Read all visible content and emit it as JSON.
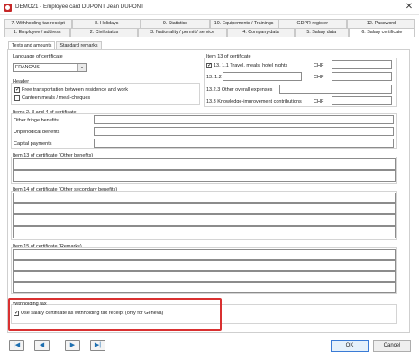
{
  "window": {
    "title": "DEMO21 - Employee card DUPONT  Jean DUPONT",
    "close_glyph": "✕"
  },
  "tabs_row1": [
    {
      "label": "7. Withholding tax receipt"
    },
    {
      "label": "8. Holidays"
    },
    {
      "label": "9. Statistics"
    },
    {
      "label": "10. Equipements / Trainings"
    },
    {
      "label": "GDPR register"
    },
    {
      "label": "12. Password"
    }
  ],
  "tabs_row2": [
    {
      "label": "1. Employee / address"
    },
    {
      "label": "2. Civil status"
    },
    {
      "label": "3. Nationality / permit / service"
    },
    {
      "label": "4. Company data"
    },
    {
      "label": "5. Salary data"
    },
    {
      "label": "6. Salary certificate"
    }
  ],
  "subtabs": [
    {
      "label": "Texts and amounts"
    },
    {
      "label": "Standard remarks"
    }
  ],
  "language": {
    "label": "Language of certificate",
    "value": "FRANCAIS"
  },
  "header": {
    "label": "Header",
    "free_transport": {
      "label": "Free transportation between residence and work",
      "checked": true
    },
    "canteen": {
      "label": "Canteen meals / meal-cheques",
      "checked": false
    }
  },
  "item13": {
    "label": "Item 13 of certificate",
    "row1_label": "13. 1.1 Travel, meals, hotel nights",
    "row1_checked": true,
    "row1_unit": "CHF",
    "row2_label": "13. 1.2",
    "row2_unit": "CHF",
    "row3_label": "13.2.3 Other overall expenses",
    "row4_label": "13.3 Knowledge-improvement contributions",
    "row4_unit": "CHF"
  },
  "items234": {
    "label": "Items 2, 3 and 4 of certificate",
    "rows": [
      {
        "label": "Other fringe benefits"
      },
      {
        "label": "Unperiodical benefits"
      },
      {
        "label": "Capital payments"
      }
    ]
  },
  "item13_other": {
    "label": "Item 13 of certificate (Other benefits)"
  },
  "item14": {
    "label": "Item 14 of certificate (Other secondary benefits)"
  },
  "item15": {
    "label": "Item 15 of certificate (Remarks)"
  },
  "withholding": {
    "label": "Withholding tax",
    "use_label": "Use salary certificate as withholding tax receipt (only for Geneva)",
    "checked": true
  },
  "footer": {
    "nav_first": "|◀",
    "nav_prev": "◀",
    "nav_next": "▶",
    "nav_last": "▶|",
    "ok_label": "OK",
    "cancel_label": "Cancel"
  },
  "colors": {
    "highlight": "#d93030",
    "nav_glyph": "#1e6fb0"
  }
}
